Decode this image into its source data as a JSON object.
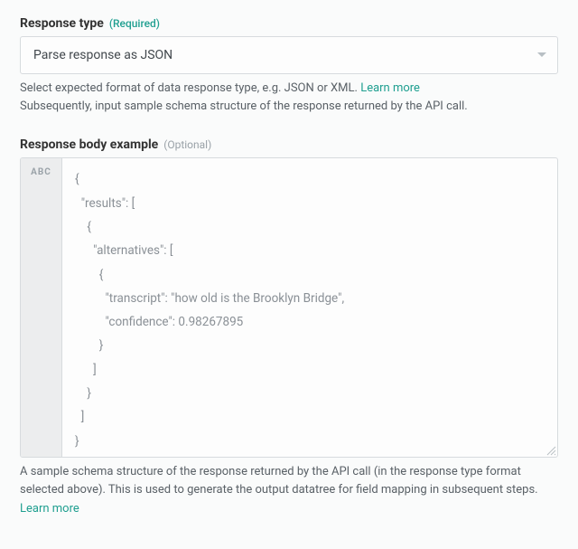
{
  "responseType": {
    "label": "Response type",
    "required": "(Required)",
    "selected": "Parse response as JSON",
    "help1": "Select expected format of data response type, e.g. JSON or XML. ",
    "learnMore": "Learn more",
    "help2": "Subsequently, input sample schema structure of the response returned by the API call."
  },
  "responseBody": {
    "label": "Response body example",
    "optional": "(Optional)",
    "gutter": "ABC",
    "code": "{\n  \"results\": [\n    {\n      \"alternatives\": [\n        {\n          \"transcript\": \"how old is the Brooklyn Bridge\",\n          \"confidence\": 0.98267895\n        }\n      ]\n    }\n  ]\n}",
    "help1": "A sample schema structure of the response returned by the API call (in the response type format selected above). This is used to generate the output datatree for field mapping in subsequent steps. ",
    "learnMore": "Learn more"
  }
}
